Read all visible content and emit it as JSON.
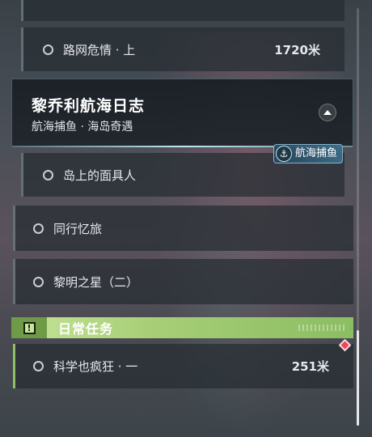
{
  "quests_top": [
    {
      "label": "路网危情 · 上",
      "distance": "1720米"
    }
  ],
  "header": {
    "title": "黎乔利航海日志",
    "subtitle": "航海捕鱼 · 海岛奇遇",
    "tag": "航海捕鱼"
  },
  "sub_quests": [
    {
      "label": "岛上的面具人"
    }
  ],
  "quests_mid": [
    {
      "label": "同行忆旅"
    },
    {
      "label": "黎明之星（二）"
    }
  ],
  "daily": {
    "title": "日常任务",
    "icon_text": "!",
    "items": [
      {
        "label": "科学也疯狂 · 一",
        "distance": "251米"
      }
    ]
  },
  "colors": {
    "daily_accent": "#a8cf78",
    "alert_marker": "#e8485a"
  }
}
